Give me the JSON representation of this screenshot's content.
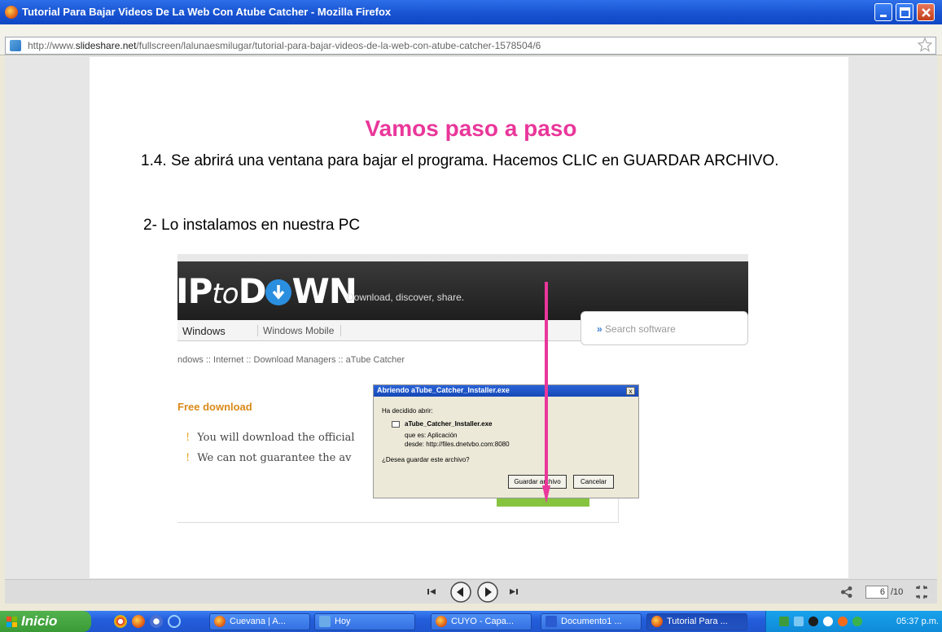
{
  "window": {
    "title": "Tutorial Para Bajar Videos De La Web Con Atube Catcher - Mozilla Firefox"
  },
  "addressbar": {
    "url_prefix": "http://www.",
    "url_domain": "slideshare.net",
    "url_path": "/fullscreen/lalunaesmilugar/tutorial-para-bajar-videos-de-la-web-con-atube-catcher-1578504/6"
  },
  "slide": {
    "title": "Vamos paso a paso",
    "step1": "1.4. Se abrirá una ventana para bajar el programa. Hacemos CLIC en    GUARDAR ARCHIVO.",
    "step2": "2- Lo instalamos en nuestra PC"
  },
  "screenshot": {
    "logo_a": "IP",
    "logo_to": "to",
    "logo_d": "D",
    "logo_wn": "WN",
    "tagline": "Download, discover, share.",
    "nav_windows": "Windows",
    "nav_mobile": "Windows Mobile",
    "search_placeholder": "Search software",
    "breadcrumb": "ndows :: Internet :: Download Managers :: aTube Catcher",
    "free_download": "Free download",
    "note1": "You will download the official",
    "note2": "We can not guarantee the av",
    "bang": "!"
  },
  "dialog": {
    "title": "Abriendo aTube_Catcher_Installer.exe",
    "close": "x",
    "intro": "Ha decidido abrir:",
    "filename": "aTube_Catcher_Installer.exe",
    "type_label": "que es:",
    "type_value": "Aplicación",
    "from_label": "desde:",
    "from_value": "http://files.dnetvbo.com:8080",
    "question": "¿Desea guardar este archivo?",
    "save_button": "Guardar archivo",
    "cancel_button": "Cancelar"
  },
  "viewer": {
    "current_page": "6",
    "total_pages": "/10"
  },
  "taskbar": {
    "start_label": "Inicio",
    "tasks": [
      "Cuevana | A...",
      "Hoy",
      "CUYO - Capa...",
      "Documento1 ...",
      "Tutorial Para ..."
    ],
    "clock": "05:37 p.m."
  },
  "colors": {
    "slide_title": "#e9379a",
    "arrow": "#e9379a",
    "titlebar": "#1853d2",
    "taskbar": "#245edb",
    "start_button": "#3a9a36"
  }
}
